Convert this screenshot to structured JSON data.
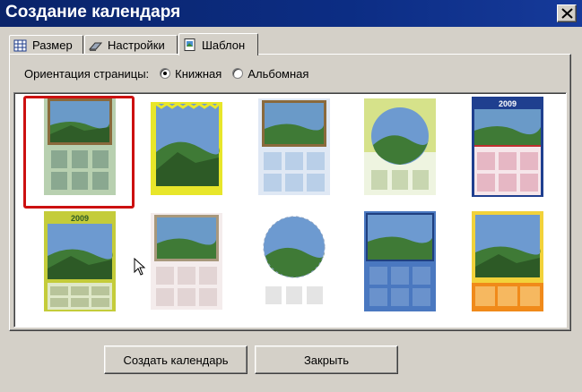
{
  "window": {
    "title": "Создание календаря"
  },
  "tabs": [
    {
      "label": "Размер",
      "icon": "grid-icon"
    },
    {
      "label": "Настройки",
      "icon": "eraser-icon"
    },
    {
      "label": "Шаблон",
      "icon": "picture-icon",
      "active": true
    }
  ],
  "orientation": {
    "label": "Ориентация страницы:",
    "options": [
      {
        "label": "Книжная",
        "checked": true
      },
      {
        "label": "Альбомная",
        "checked": false
      }
    ]
  },
  "templates": {
    "selected_index": 0,
    "year_labels": {
      "template_5": "2009",
      "template_6": "2009"
    }
  },
  "buttons": {
    "create": "Создать календарь",
    "close": "Закрыть"
  },
  "colors": {
    "titlebar": "#0a246a",
    "selection": "#cc1010",
    "face": "#d4d0c8"
  }
}
